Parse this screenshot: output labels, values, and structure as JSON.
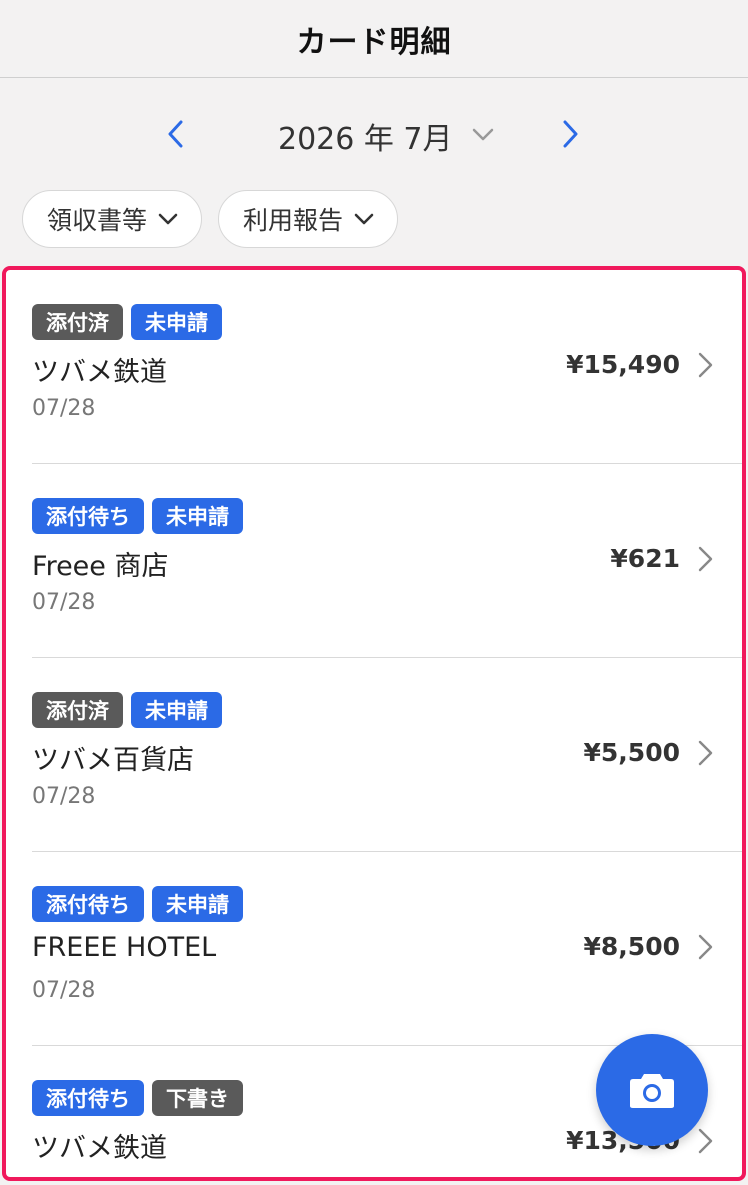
{
  "header": {
    "title": "カード明細"
  },
  "month_nav": {
    "label": "2026 年 7月"
  },
  "filters": [
    {
      "label": "領収書等"
    },
    {
      "label": "利用報告"
    }
  ],
  "transactions": [
    {
      "badges": [
        {
          "text": "添付済",
          "color": "gray"
        },
        {
          "text": "未申請",
          "color": "blue"
        }
      ],
      "merchant": "ツバメ鉄道",
      "date": "07/28",
      "amount": "¥15,490"
    },
    {
      "badges": [
        {
          "text": "添付待ち",
          "color": "blue"
        },
        {
          "text": "未申請",
          "color": "blue"
        }
      ],
      "merchant": "Freee 商店",
      "date": "07/28",
      "amount": "¥621"
    },
    {
      "badges": [
        {
          "text": "添付済",
          "color": "gray"
        },
        {
          "text": "未申請",
          "color": "blue"
        }
      ],
      "merchant": "ツバメ百貨店",
      "date": "07/28",
      "amount": "¥5,500"
    },
    {
      "badges": [
        {
          "text": "添付待ち",
          "color": "blue"
        },
        {
          "text": "未申請",
          "color": "blue"
        }
      ],
      "merchant": "FREEE HOTEL",
      "date": "07/28",
      "amount": "¥8,500"
    },
    {
      "badges": [
        {
          "text": "添付待ち",
          "color": "blue"
        },
        {
          "text": "下書き",
          "color": "gray"
        }
      ],
      "merchant": "ツバメ鉄道",
      "date": "",
      "amount": "¥13,500"
    }
  ],
  "colors": {
    "accent": "#2b6ae6",
    "badge_gray": "#5a5a5a",
    "highlight_border": "#f0195c"
  },
  "fab": {
    "icon": "camera-icon"
  }
}
